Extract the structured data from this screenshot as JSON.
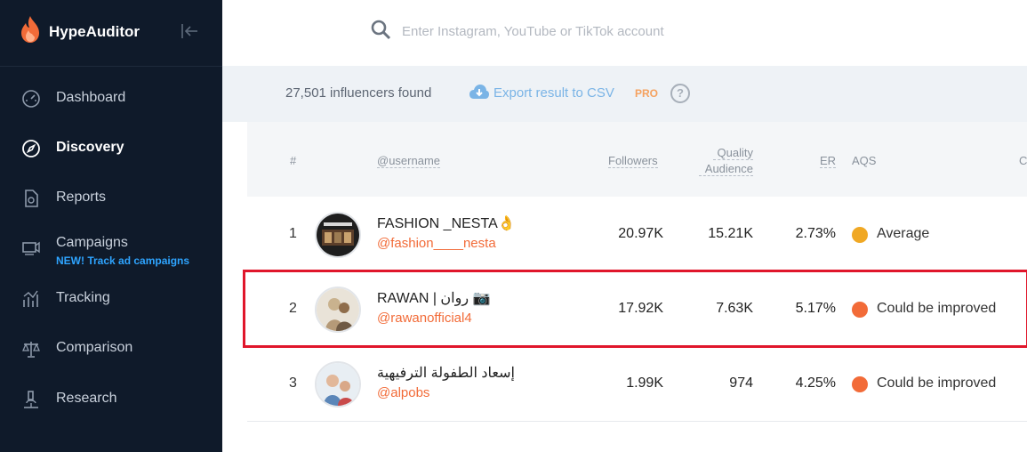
{
  "app": {
    "name": "HypeAuditor",
    "brand_color": "#f26b38",
    "sidebar_bg": "#0f1a2a"
  },
  "sidebar": {
    "items": [
      {
        "label": "Dashboard",
        "icon": "dashboard-gauge-icon",
        "active": false
      },
      {
        "label": "Discovery",
        "icon": "compass-icon",
        "active": true
      },
      {
        "label": "Reports",
        "icon": "report-document-icon",
        "active": false
      },
      {
        "label": "Campaigns",
        "icon": "campaign-icon",
        "active": false,
        "sublabel": "NEW! Track ad campaigns"
      },
      {
        "label": "Tracking",
        "icon": "tracking-chart-icon",
        "active": false
      },
      {
        "label": "Comparison",
        "icon": "scales-icon",
        "active": false
      },
      {
        "label": "Research",
        "icon": "microscope-icon",
        "active": false
      }
    ]
  },
  "search": {
    "placeholder": "Enter Instagram, YouTube or TikTok account",
    "value": ""
  },
  "results": {
    "found_text": "27,501 influencers found",
    "export_label": "Export result to CSV",
    "pro_badge": "PRO",
    "help": "?"
  },
  "table": {
    "headers": {
      "rank": "#",
      "username": "@username",
      "followers": "Followers",
      "quality_1": "Quality",
      "quality_2": "Audience",
      "er": "ER",
      "aqs": "AQS",
      "extra": "C"
    },
    "rows": [
      {
        "rank": "1",
        "name": "FASHION _NESTA👌",
        "handle": "@fashion____nesta",
        "followers": "20.97K",
        "quality": "15.21K",
        "er": "2.73%",
        "aqs": "Average",
        "aqs_color": "#f0a824"
      },
      {
        "rank": "2",
        "name": "RAWAN | روان 📷",
        "handle": "@rawanofficial4",
        "followers": "17.92K",
        "quality": "7.63K",
        "er": "5.17%",
        "aqs": "Could be improved",
        "aqs_color": "#f26b38"
      },
      {
        "rank": "3",
        "name": "إسعاد الطفولة الترفيهية",
        "handle": "@alpobs",
        "followers": "1.99K",
        "quality": "974",
        "er": "4.25%",
        "aqs": "Could be improved",
        "aqs_color": "#f26b38"
      }
    ]
  },
  "highlight_color": "#e0162b"
}
